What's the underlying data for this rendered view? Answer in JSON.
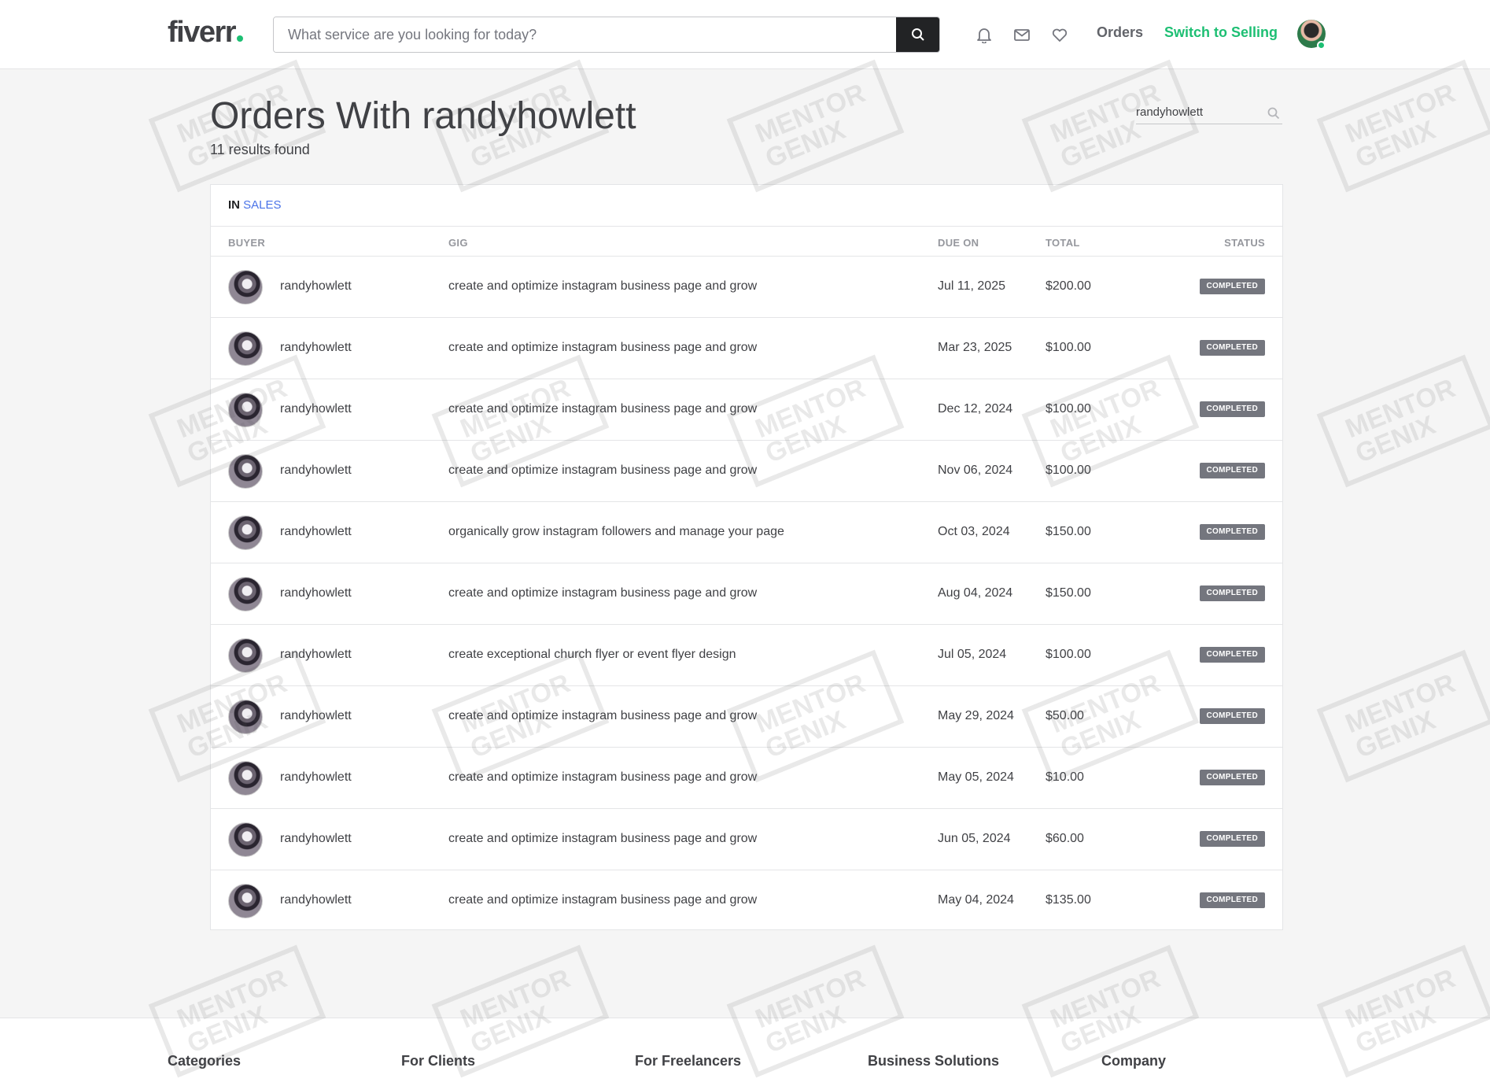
{
  "header": {
    "logo": "fiverr",
    "search_placeholder": "What service are you looking for today?",
    "nav_orders": "Orders",
    "nav_switch": "Switch to Selling"
  },
  "page": {
    "title_prefix": "Orders With",
    "title_user": "randyhowlett",
    "results": "11 results found",
    "filter_value": "randyhowlett"
  },
  "table": {
    "section_prefix": "IN",
    "section_link": "SALES",
    "columns": [
      "BUYER",
      "GIG",
      "DUE ON",
      "TOTAL",
      "STATUS"
    ],
    "rows": [
      {
        "buyer": "randyhowlett",
        "gig": "create and optimize instagram business page and grow",
        "due": "Jul 11, 2025",
        "total": "$200.00",
        "status": "COMPLETED"
      },
      {
        "buyer": "randyhowlett",
        "gig": "create and optimize instagram business page and grow",
        "due": "Mar 23, 2025",
        "total": "$100.00",
        "status": "COMPLETED"
      },
      {
        "buyer": "randyhowlett",
        "gig": "create and optimize instagram business page and grow",
        "due": "Dec 12, 2024",
        "total": "$100.00",
        "status": "COMPLETED"
      },
      {
        "buyer": "randyhowlett",
        "gig": "create and optimize instagram business page and grow",
        "due": "Nov 06, 2024",
        "total": "$100.00",
        "status": "COMPLETED"
      },
      {
        "buyer": "randyhowlett",
        "gig": "organically grow instagram followers and manage your page",
        "due": "Oct 03, 2024",
        "total": "$150.00",
        "status": "COMPLETED"
      },
      {
        "buyer": "randyhowlett",
        "gig": "create and optimize instagram business page and grow",
        "due": "Aug 04, 2024",
        "total": "$150.00",
        "status": "COMPLETED"
      },
      {
        "buyer": "randyhowlett",
        "gig": "create exceptional church flyer or event flyer design",
        "due": "Jul 05, 2024",
        "total": "$100.00",
        "status": "COMPLETED"
      },
      {
        "buyer": "randyhowlett",
        "gig": "create and optimize instagram business page and grow",
        "due": "May 29, 2024",
        "total": "$50.00",
        "status": "COMPLETED"
      },
      {
        "buyer": "randyhowlett",
        "gig": "create and optimize instagram business page and grow",
        "due": "May 05, 2024",
        "total": "$10.00",
        "status": "COMPLETED"
      },
      {
        "buyer": "randyhowlett",
        "gig": "create and optimize instagram business page and grow",
        "due": "Jun 05, 2024",
        "total": "$60.00",
        "status": "COMPLETED"
      },
      {
        "buyer": "randyhowlett",
        "gig": "create and optimize instagram business page and grow",
        "due": "May 04, 2024",
        "total": "$135.00",
        "status": "COMPLETED"
      }
    ]
  },
  "footer": {
    "columns": [
      "Categories",
      "For Clients",
      "For Freelancers",
      "Business Solutions",
      "Company"
    ]
  },
  "watermark": "MENTOR\nGENIX",
  "colors": {
    "brand_green": "#1dbf73",
    "link_blue": "#4a73e8",
    "badge_grey": "#74767e"
  }
}
